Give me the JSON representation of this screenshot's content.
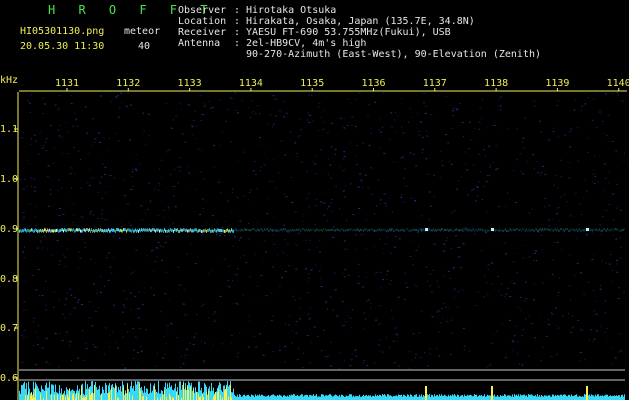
{
  "header": {
    "brand": "H R O F F T",
    "filename": "HI05301130.png",
    "meteor_label": "meteor",
    "datetime": "20.05.30 11:30",
    "meteor_count": "40"
  },
  "info": [
    {
      "key": "Observer",
      "value": "Hirotaka Otsuka"
    },
    {
      "key": "Location",
      "value": "Hirakata, Osaka, Japan (135.7E, 34.8N)"
    },
    {
      "key": "Receiver",
      "value": "YAESU FT-690 53.755MHz(Fukui), USB"
    },
    {
      "key": "Antenna",
      "value": "2el-HB9CV, 4m's high"
    },
    {
      "key": "",
      "value": "90-270-Azimuth (East-West), 90-Elevation (Zenith)"
    }
  ],
  "axes": {
    "y_unit": "kHz",
    "x_ticks": [
      "1131",
      "1132",
      "1133",
      "1134",
      "1135",
      "1136",
      "1137",
      "1138",
      "1139",
      "1140"
    ],
    "y_ticks": [
      "1.1",
      "1.0",
      "0.9",
      "0.8",
      "0.7",
      "0.6"
    ]
  },
  "colors": {
    "background": "#000000",
    "axis": "#f2ee5a",
    "text": "#e6e6e6",
    "brand": "#4be24b",
    "noise": "#1a1f66",
    "signal": "#40e0ff",
    "histogram": "#38d8f8",
    "histogram_peak": "#f6f24a"
  }
}
